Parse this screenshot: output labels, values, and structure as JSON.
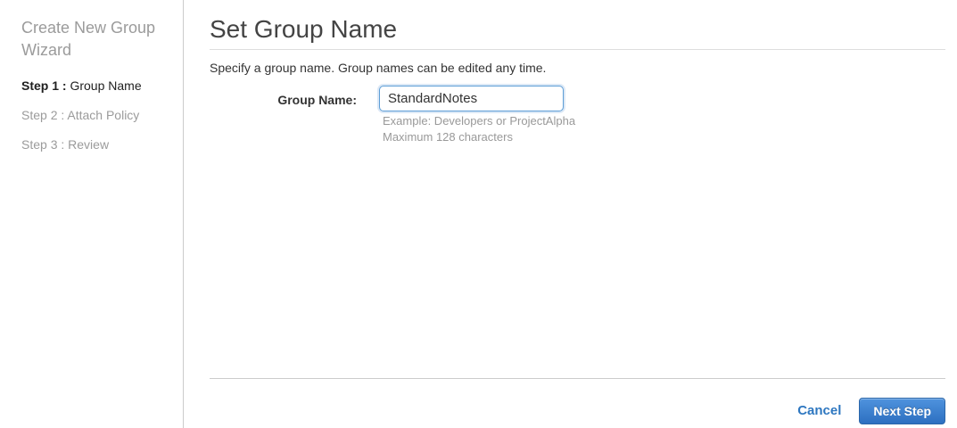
{
  "sidebar": {
    "title": "Create New Group Wizard",
    "steps": [
      {
        "prefix": "Step 1 : ",
        "label": "Group Name",
        "active": true
      },
      {
        "prefix": "Step 2 : ",
        "label": "Attach Policy",
        "active": false
      },
      {
        "prefix": "Step 3 : ",
        "label": "Review",
        "active": false
      }
    ]
  },
  "main": {
    "title": "Set Group Name",
    "description": "Specify a group name. Group names can be edited any time.",
    "form": {
      "label": "Group Name:",
      "value": "StandardNotes",
      "hint_example": "Example: Developers or ProjectAlpha",
      "hint_max": "Maximum 128 characters"
    },
    "footer": {
      "cancel_label": "Cancel",
      "next_label": "Next Step"
    }
  },
  "colors": {
    "link_blue": "#2e77c0",
    "button_gradient_top": "#4f93de",
    "button_gradient_bottom": "#2d6fc0",
    "input_focus_border": "#5e9ed6",
    "muted_text": "#999999",
    "heading_text": "#444444"
  }
}
